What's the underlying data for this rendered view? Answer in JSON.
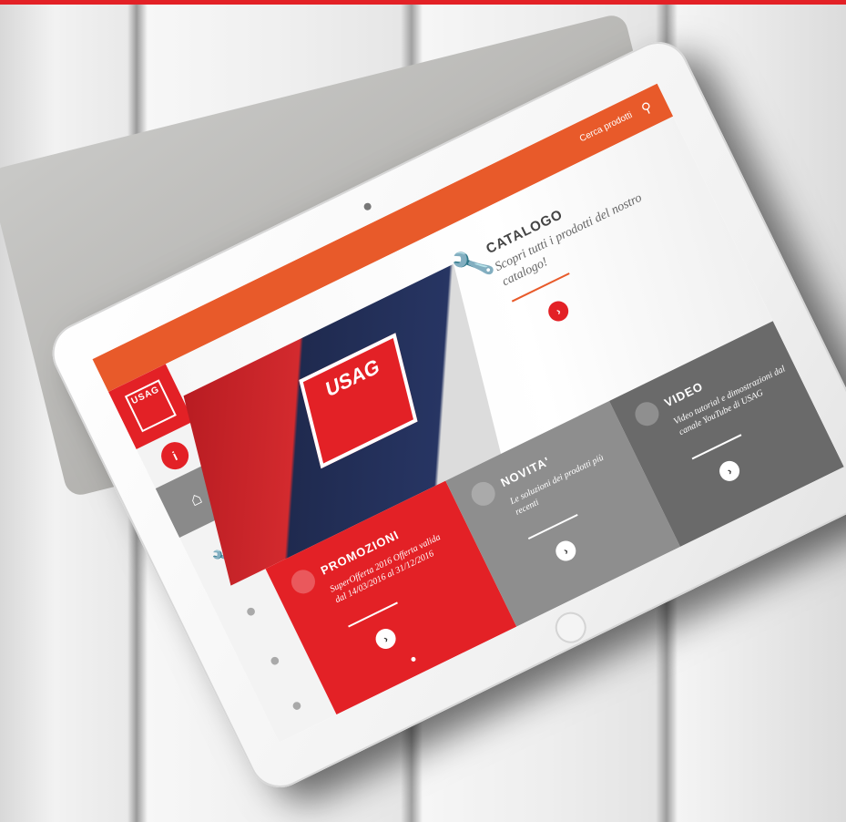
{
  "header": {
    "search_label": "Cerca prodotti",
    "search_icon": "search-icon"
  },
  "sidebar": {
    "logo_text": "USAG",
    "info_icon": "info-icon",
    "items": [
      {
        "name": "home",
        "icon": "home-icon",
        "glyph": "⌂"
      },
      {
        "name": "catalog",
        "icon": "wrench-icon",
        "glyph": "🔧"
      },
      {
        "name": "promo",
        "icon": "promo-icon",
        "glyph": "●"
      },
      {
        "name": "news",
        "icon": "news-icon",
        "glyph": "●"
      },
      {
        "name": "video",
        "icon": "video-icon",
        "glyph": "●"
      }
    ]
  },
  "hero": {
    "book_logo": "USAG",
    "title": "CATALOGO",
    "subtitle": "Scopri tutti i prodotti del nostro catalogo!",
    "button_glyph": "›"
  },
  "tiles": {
    "promo": {
      "title": "PROMOZIONI",
      "body": "SuperOfferta 2016 Offerta valida dal 14/03/2016 al 31/12/2016",
      "button_glyph": "›"
    },
    "news": {
      "title": "NOVITA'",
      "body": "Le soluzioni dei prodotti più recenti",
      "button_glyph": "›"
    },
    "video": {
      "title": "VIDEO",
      "body": "Video tutorial e dimostrazioni dal canale YouTube di USAG",
      "button_glyph": "›"
    }
  },
  "colors": {
    "brand_red": "#e32126",
    "header_orange": "#e85a2a",
    "tile_grey": "#8e8e8e",
    "tile_dark_grey": "#6a6a6a"
  }
}
